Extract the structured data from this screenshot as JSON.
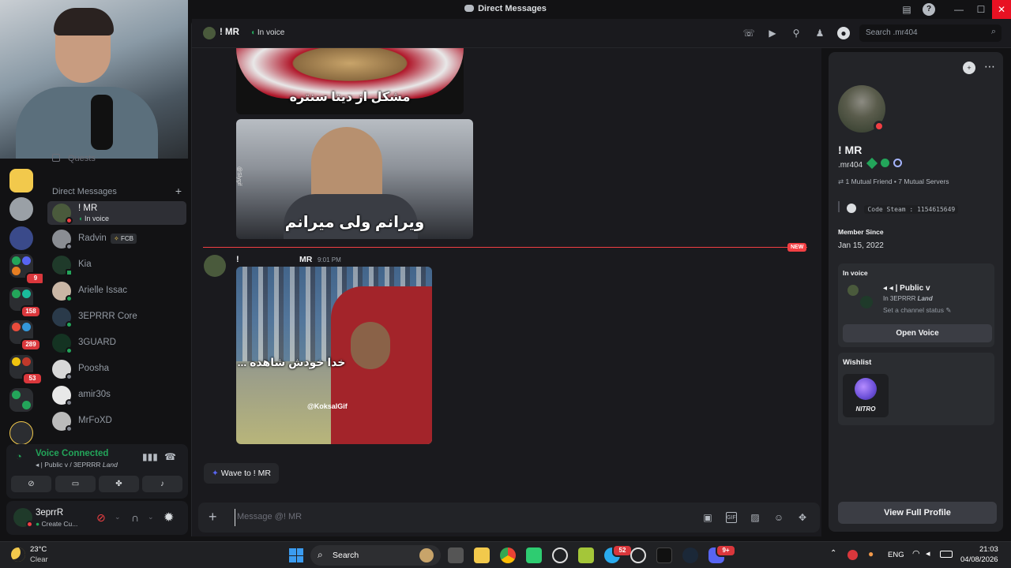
{
  "window": {
    "title": "Direct Messages"
  },
  "dm_header": {
    "name": "! MR",
    "status": "In voice"
  },
  "search": {
    "placeholder": "Search .mr404"
  },
  "sidebar": {
    "quests_label": "Quests",
    "section_title": "Direct Messages",
    "dms": [
      {
        "name": "! MR",
        "sub": "In voice",
        "status_color": "#f23f43",
        "avatar_color": "#4a5a3c"
      },
      {
        "name": "Radvin",
        "tag": "FCB",
        "status_color": "#80848e",
        "avatar_color": "#8a8d93"
      },
      {
        "name": "Kia",
        "status_color": "#23a55a",
        "avatar_color": "#1f3a2a"
      },
      {
        "name": "Arielle Issac",
        "status_color": "#23a55a",
        "avatar_color": "#c9b6a5"
      },
      {
        "name": "3EPRRR Core",
        "status_color": "#23a55a",
        "avatar_color": "#2a3a4a"
      },
      {
        "name": "3GUARD",
        "status_color": "#23a55a",
        "avatar_color": "#143322"
      },
      {
        "name": "Poosha",
        "status_color": "#80848e",
        "avatar_color": "#d8d8d8"
      },
      {
        "name": "amir30s",
        "status_color": "#80848e",
        "avatar_color": "#e8e8e8"
      },
      {
        "name": "MrFoXD",
        "status_color": "#80848e",
        "avatar_color": "#bbbbbb"
      }
    ],
    "server_badges": [
      "9",
      "158",
      "289",
      "53"
    ]
  },
  "voice": {
    "title": "Voice Connected",
    "channel": "| Public v / 3EPRRR",
    "channel_em": "Land"
  },
  "user": {
    "name": "3eprrR",
    "status": "Create Cu..."
  },
  "messages": {
    "img1_caption": "مشکل از دیتا سنتره",
    "img2_caption": "ویرانم ولی میرانم",
    "img2_side": "@Slygif",
    "new_label": "NEW",
    "author_prefix": "!",
    "author": "MR",
    "time": "9:01 PM",
    "img3_caption": "خدا خودش شاهده ...",
    "img3_watermark": "@KoksalGif",
    "wave_label": "Wave to ! MR"
  },
  "composer": {
    "placeholder": "Message @! MR"
  },
  "profile": {
    "name": "! MR",
    "handle": ".mr404",
    "mutuals": "1 Mutual Friend • 7 Mutual Servers",
    "code_steam": "Code Steam : 1154615649",
    "member_since_label": "Member Since",
    "member_since": "Jan 15, 2022",
    "in_voice_label": "In voice",
    "voice_channel": "| Public v",
    "voice_server": "In 3EPRRR",
    "voice_server_em": "Land",
    "channel_status": "Set a channel status",
    "open_voice": "Open Voice",
    "wishlist_label": "Wishlist",
    "nitro": "NITRO",
    "view_full": "View Full Profile"
  },
  "taskbar": {
    "weather_temp": "23°C",
    "weather_desc": "Clear",
    "search": "Search",
    "lang": "ENG",
    "time": "21:03",
    "date": "04/08/2026",
    "discord_badge": "9+",
    "telegram_badge": "52"
  },
  "colors": {
    "accent_red": "#f23f43",
    "green": "#23a55a",
    "bg": "#1a1a1e"
  }
}
